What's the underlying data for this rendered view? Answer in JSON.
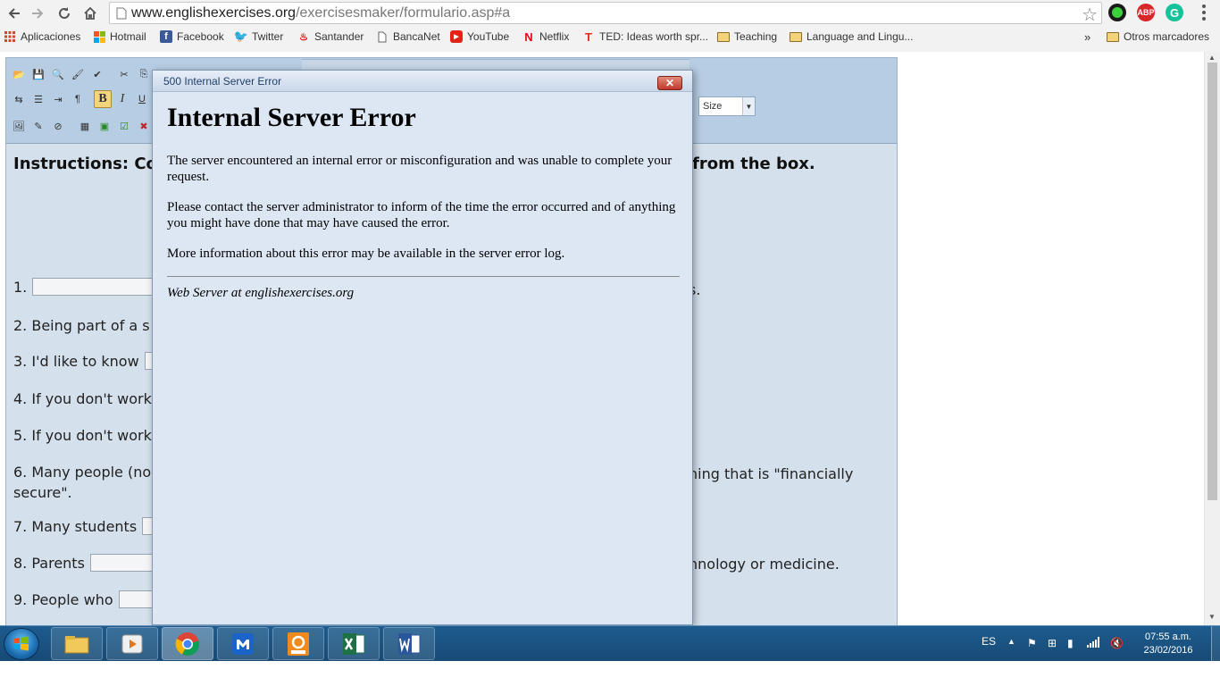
{
  "browser": {
    "url_host": "www.englishexercises.org",
    "url_path": "/exercisesmaker/formulario.asp#a",
    "bookmarks": [
      {
        "label": "Aplicaciones"
      },
      {
        "label": "Hotmail"
      },
      {
        "label": "Facebook"
      },
      {
        "label": "Twitter"
      },
      {
        "label": "Santander"
      },
      {
        "label": "BancaNet"
      },
      {
        "label": "YouTube"
      },
      {
        "label": "Netflix"
      },
      {
        "label": "TED: Ideas worth spr..."
      },
      {
        "label": "Teaching"
      },
      {
        "label": "Language and Lingu..."
      },
      {
        "label": "Otros marcadores"
      }
    ],
    "bookmarks_overflow": "»",
    "extension_abp": "ABP"
  },
  "editor": {
    "size_select": "Size",
    "bold_label": "B",
    "italic_label": "I",
    "underline_label": "U",
    "instructions_start": "Instructions: Co",
    "instructions_end": "from the box.",
    "questions": [
      {
        "num": "1.",
        "text": "",
        "tail": "s."
      },
      {
        "num": "2.",
        "text": "Being part of a s",
        "tail": ""
      },
      {
        "num": "3.",
        "text": "I'd like to know",
        "tail": ""
      },
      {
        "num": "4.",
        "text": "If you don't work",
        "tail": ""
      },
      {
        "num": "5.",
        "text": "If you don't work",
        "tail": ""
      },
      {
        "num": "6.",
        "text": "Many people (no",
        "tail": "hing that is \"financially"
      },
      {
        "num": "",
        "text": "secure\".",
        "tail": ""
      },
      {
        "num": "7.",
        "text": "Many students",
        "tail": ""
      },
      {
        "num": "8.",
        "text": "Parents",
        "tail": "hnology or medicine."
      },
      {
        "num": "9.",
        "text": "People who",
        "tail": ""
      }
    ]
  },
  "dialog": {
    "title": "500 Internal Server Error",
    "close_label": "✕",
    "heading": "Internal Server Error",
    "para1": "The server encountered an internal error or misconfiguration and was unable to complete your request.",
    "para2": "Please contact the server administrator to inform of the time the error occurred and of anything you might have done that may have caused the error.",
    "para3": "More information about this error may be available in the server error log.",
    "server": "Web Server at englishexercises.org"
  },
  "taskbar": {
    "language": "ES",
    "time": "07:55 a.m.",
    "date": "23/02/2016",
    "apps": [
      {
        "name": "explorer"
      },
      {
        "name": "media-player"
      },
      {
        "name": "chrome"
      },
      {
        "name": "maxthon"
      },
      {
        "name": "pdf-tool"
      },
      {
        "name": "excel"
      },
      {
        "name": "word"
      }
    ]
  },
  "colors": {
    "editor_bg": "#d4e0ec",
    "toolbar_bg": "#b7cde3",
    "dialog_bg": "#dde7f3",
    "taskbar": "#1d5c8e",
    "close_red": "#c1392b"
  }
}
